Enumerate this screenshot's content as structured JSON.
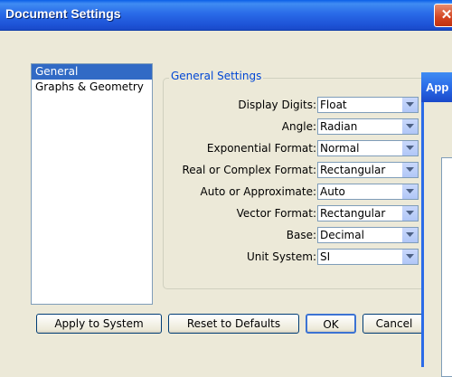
{
  "window": {
    "title": "Document Settings",
    "close_symbol": "✕"
  },
  "categories": [
    {
      "label": "General",
      "selected": true
    },
    {
      "label": "Graphs & Geometry",
      "selected": false
    }
  ],
  "group": {
    "title": "General Settings",
    "rows": [
      {
        "label": "Display Digits:",
        "value": "Float"
      },
      {
        "label": "Angle:",
        "value": "Radian"
      },
      {
        "label": "Exponential Format:",
        "value": "Normal"
      },
      {
        "label": "Real or Complex Format:",
        "value": "Rectangular"
      },
      {
        "label": "Auto or Approximate:",
        "value": "Auto"
      },
      {
        "label": "Vector Format:",
        "value": "Rectangular"
      },
      {
        "label": "Base:",
        "value": "Decimal"
      },
      {
        "label": "Unit System:",
        "value": "SI"
      }
    ]
  },
  "buttons": {
    "apply": "Apply to System",
    "reset": "Reset to Defaults",
    "ok": "OK",
    "cancel": "Cancel"
  },
  "background_window": {
    "title": "App"
  },
  "colors": {
    "selection": "#316ac5",
    "title_bar": "#2a6be8",
    "group_title": "#0046d5"
  }
}
